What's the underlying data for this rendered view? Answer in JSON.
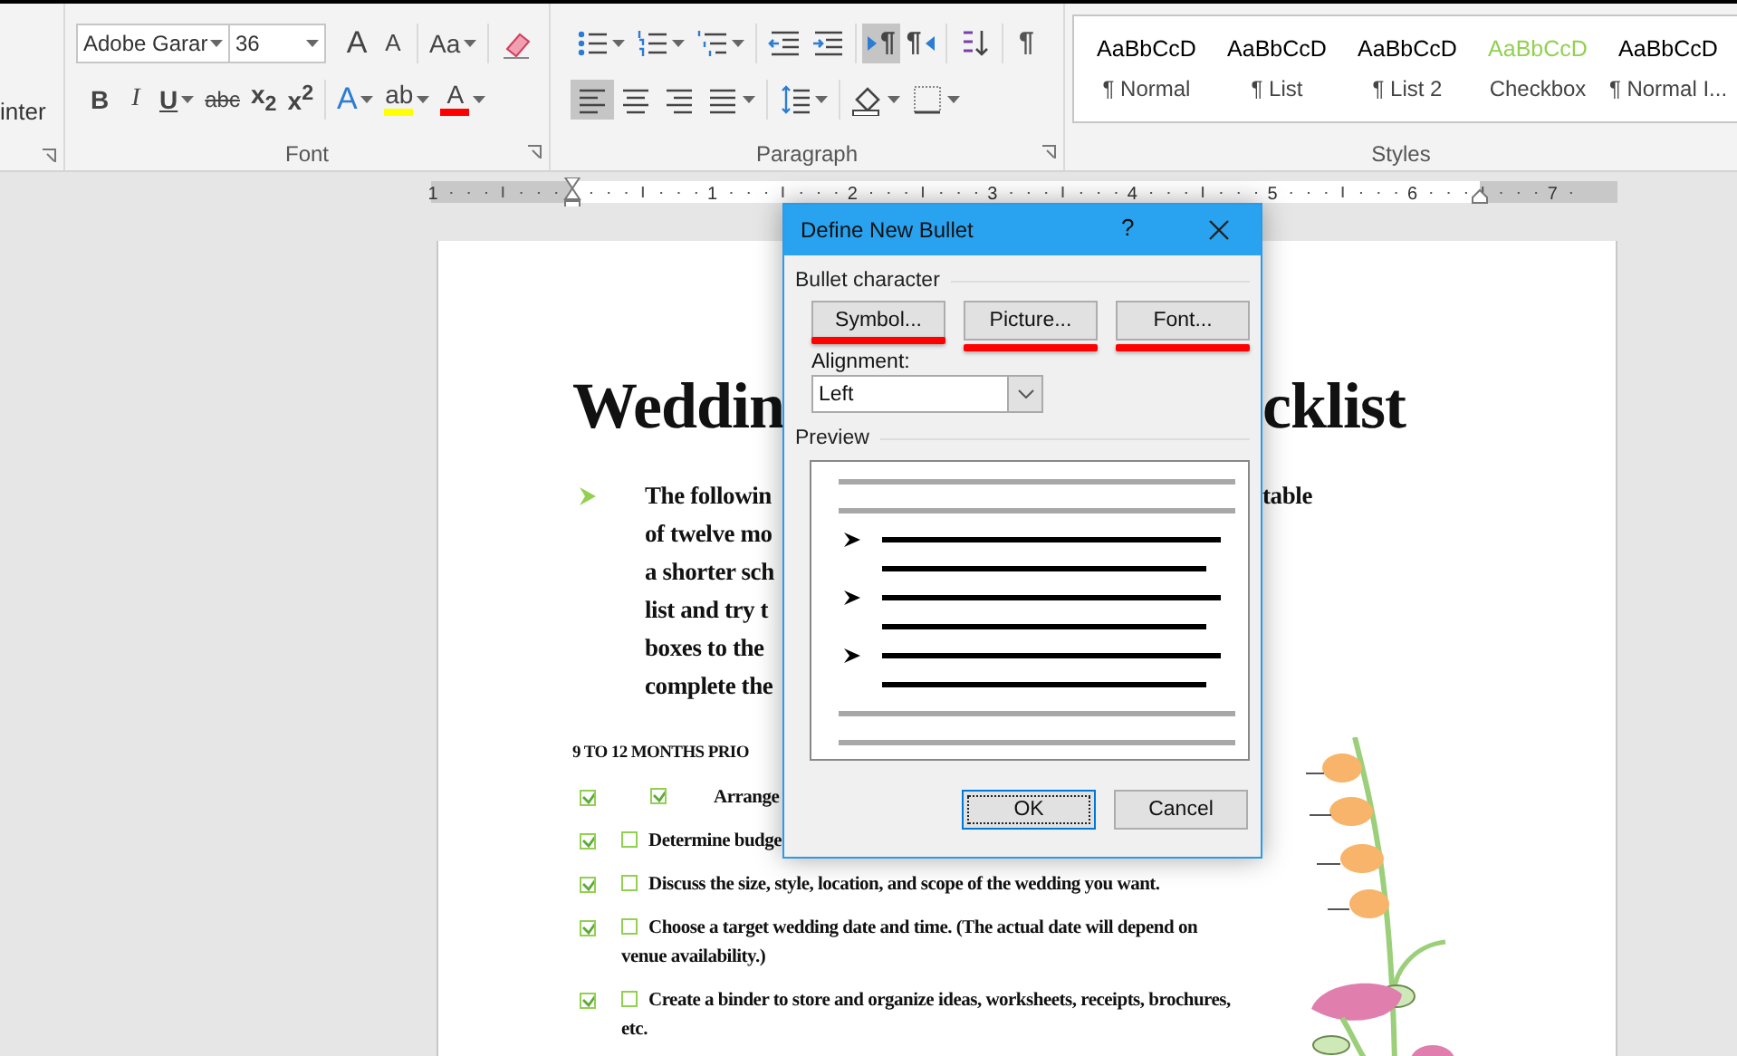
{
  "ribbon": {
    "clipboard": {
      "label_fragment": "inter"
    },
    "font": {
      "label": "Font",
      "font_name": "Adobe Garar",
      "font_size": "36",
      "row1": [
        [
          {
            "kind": "grow",
            "label": "A",
            "dropdown": false,
            "selected": false
          },
          {
            "kind": "shrink",
            "label": "A",
            "dropdown": false,
            "selected": false
          }
        ],
        [
          {
            "kind": "case",
            "label": "Aa",
            "dropdown": true,
            "selected": false
          }
        ],
        [
          {
            "kind": "clear",
            "dropdown": false,
            "selected": false
          }
        ]
      ],
      "row2": [
        [
          {
            "kind": "bold",
            "label": "B",
            "dropdown": false,
            "selected": false
          },
          {
            "kind": "italic",
            "label": "I",
            "dropdown": false,
            "selected": false
          },
          {
            "kind": "underline",
            "label": "U",
            "dropdown": true,
            "selected": false
          },
          {
            "kind": "strike",
            "label": "abc",
            "dropdown": false,
            "selected": false
          },
          {
            "kind": "subscript",
            "label": "x$_{2}$",
            "dropdown": false,
            "selected": false
          },
          {
            "kind": "superscript",
            "label": "x$^{2}$",
            "dropdown": false,
            "selected": false
          }
        ],
        [
          {
            "kind": "effects",
            "label": "A",
            "dropdown": true,
            "selected": false
          },
          {
            "kind": "highlight",
            "label": "ab",
            "dropdown": true,
            "selected": false,
            "color": "#ffff00"
          },
          {
            "kind": "fontcolor",
            "label": "A",
            "dropdown": true,
            "selected": false,
            "color": "#ff0000"
          }
        ]
      ]
    },
    "paragraph": {
      "label": "Paragraph",
      "row1": [
        [
          {
            "kind": "bullets",
            "dropdown": true,
            "selected": false
          },
          {
            "kind": "numbering",
            "dropdown": true,
            "selected": false
          },
          {
            "kind": "multilevel",
            "dropdown": true,
            "selected": false
          }
        ],
        [
          {
            "kind": "outdent",
            "dropdown": false,
            "selected": false
          },
          {
            "kind": "indent",
            "dropdown": false,
            "selected": false
          }
        ],
        [
          {
            "kind": "ltr",
            "label": "¶",
            "dropdown": false,
            "selected": true
          },
          {
            "kind": "rtl",
            "label": "¶",
            "dropdown": false,
            "selected": false
          }
        ],
        [
          {
            "kind": "sort",
            "dropdown": false,
            "selected": false
          }
        ],
        [
          {
            "kind": "marks",
            "label": "¶",
            "dropdown": false,
            "selected": false
          }
        ]
      ],
      "row2": [
        [
          {
            "kind": "left",
            "dropdown": false,
            "selected": true
          },
          {
            "kind": "center",
            "dropdown": false,
            "selected": false
          },
          {
            "kind": "right",
            "dropdown": false,
            "selected": false
          },
          {
            "kind": "justify",
            "dropdown": true,
            "selected": false
          }
        ],
        [
          {
            "kind": "spacing",
            "dropdown": true,
            "selected": false
          }
        ],
        [
          {
            "kind": "shading",
            "dropdown": true,
            "selected": false
          },
          {
            "kind": "borders",
            "dropdown": true,
            "selected": false
          }
        ]
      ]
    },
    "styles": {
      "label": "Styles",
      "items": [
        {
          "preview": "AaBbCcD",
          "name": "¶ Normal",
          "color": "#000000"
        },
        {
          "preview": "AaBbCcD",
          "name": "¶ List",
          "color": "#000000"
        },
        {
          "preview": "AaBbCcD",
          "name": "¶ List 2",
          "color": "#000000"
        },
        {
          "preview": "AaBbCcD",
          "name": "Checkbox",
          "color": "#92d050"
        },
        {
          "preview": "AaBbCcD",
          "name": "¶ Normal I...",
          "color": "#000000"
        }
      ]
    }
  },
  "ruler": {
    "labels": [
      "1",
      "1",
      "2",
      "3",
      "4",
      "5",
      "6",
      "7"
    ]
  },
  "document": {
    "title_left": "Weddin",
    "title_right": "cklist",
    "intro": [
      {
        "text": "The followin",
        "tail": "table"
      },
      {
        "text": "of twelve mo"
      },
      {
        "text": "a shorter sch"
      },
      {
        "text": "list and try t"
      },
      {
        "text": "boxes to the"
      },
      {
        "text": "complete the"
      }
    ],
    "heading": "9 TO 12 MONTHS PRIO",
    "checklist": [
      {
        "kind": "tabbed",
        "outer_checked": true,
        "inner_checked": true,
        "text": "Arrange"
      },
      {
        "kind": "inline",
        "outer_checked": true,
        "inner_checked": false,
        "text": "Determine budge"
      },
      {
        "kind": "inline",
        "outer_checked": true,
        "inner_checked": false,
        "text": "Discuss the size, style, location, and scope of the wedding you want."
      },
      {
        "kind": "inline",
        "outer_checked": true,
        "inner_checked": false,
        "text": "Choose a target wedding date and time. (The actual date will depend on",
        "more": "venue availability.)"
      },
      {
        "kind": "inline",
        "outer_checked": true,
        "inner_checked": false,
        "text": "Create a binder to store and organize ideas, worksheets, receipts, brochures,",
        "more": "etc."
      }
    ]
  },
  "dialog": {
    "title": "Define New Bullet",
    "help": "?",
    "section": "Bullet character",
    "buttons": [
      {
        "label": "Symbol...",
        "marked": true
      },
      {
        "label": "Picture...",
        "marked": true
      },
      {
        "label": "Font...",
        "marked": true
      }
    ],
    "alignment_label": "Alignment:",
    "alignment_value": "Left",
    "preview_label": "Preview",
    "actions": [
      {
        "label": "OK",
        "default": true
      },
      {
        "label": "Cancel",
        "default": false
      }
    ]
  }
}
